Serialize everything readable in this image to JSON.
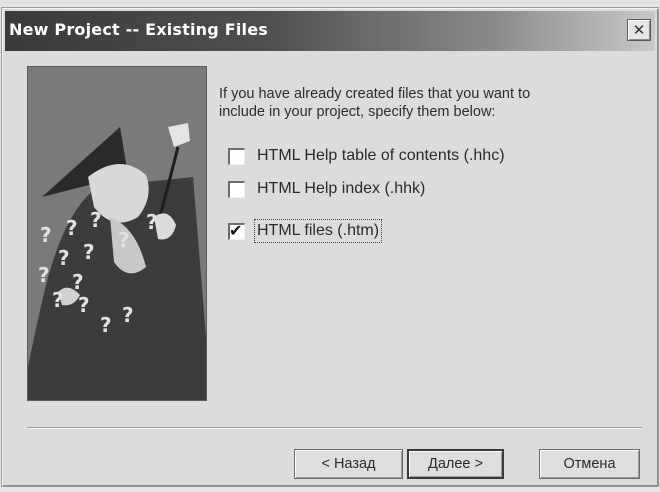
{
  "window": {
    "title": "New Project -- Existing Files",
    "close_glyph": "✕"
  },
  "intro_text": "If you have already created files that you want to include in your project, specify them below:",
  "checkboxes": [
    {
      "label": "HTML Help table of contents (.hhc)",
      "checked": false
    },
    {
      "label": "HTML Help index (.hhk)",
      "checked": false
    },
    {
      "label": "HTML files (.htm)",
      "checked": true
    }
  ],
  "buttons": {
    "back": "< Назад",
    "next": "Далее >",
    "cancel": "Отмена"
  },
  "illustration": {
    "icon": "wizard-icon",
    "marks": [
      "?",
      "?",
      "?",
      "?",
      "?",
      "?",
      "?",
      "?",
      "?",
      "?",
      "?",
      "?",
      "?"
    ]
  }
}
